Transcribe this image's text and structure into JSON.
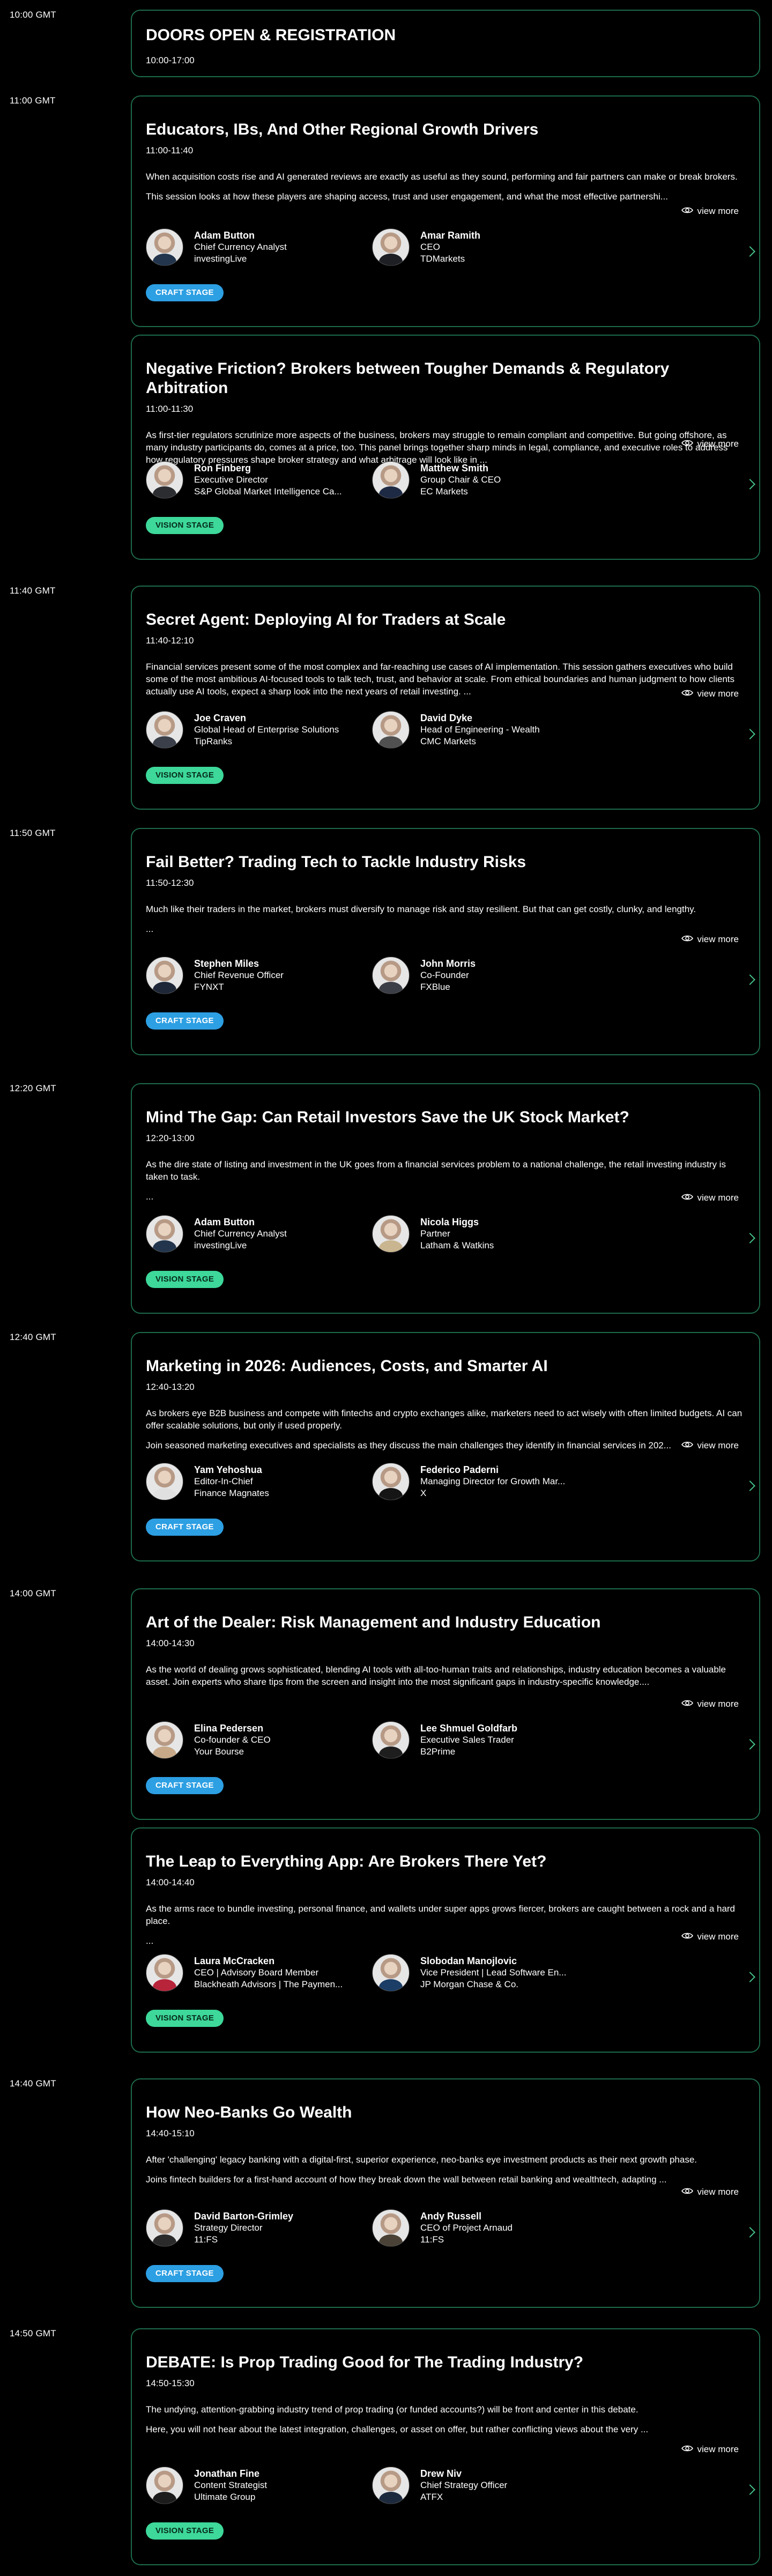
{
  "agenda": [
    {
      "time": "10:00 GMT",
      "sessions": [
        {
          "title": "DOORS OPEN & REGISTRATION",
          "time": "10:00-17:00",
          "simple": true
        }
      ]
    },
    {
      "time": "11:00 GMT",
      "sessions": [
        {
          "title": "Educators, IBs, And Other Regional Growth Drivers",
          "time": "11:00-11:40",
          "desc": [
            "When acquisition costs rise and AI generated reviews are exactly as useful as they sound, performing and fair partners can make or break brokers.",
            "This session looks at how these players are shaping access, trust and user engagement, and what the most effective partnershi..."
          ],
          "view_more": "view more",
          "speakers": [
            {
              "name": "Adam Button",
              "role": "Chief Currency Analyst",
              "org": "investingLive",
              "shirt": "#22354d"
            },
            {
              "name": "Amar Ramith",
              "role": "CEO",
              "org": "TDMarkets",
              "shirt": "#1d1f24"
            }
          ],
          "tag": "CRAFT STAGE",
          "tag_type": "craft"
        },
        {
          "title": "Negative Friction? Brokers between Tougher Demands & Regulatory Arbitration",
          "time": "11:00-11:30",
          "desc": [
            "As first-tier regulators scrutinize more aspects of the business, brokers may struggle to remain compliant and competitive. But going offshore, as many industry participants do, comes at a price, too.  This panel brings together sharp minds in legal, compliance, and executive roles to address how regulatory pressures shape broker strategy and what arbitrage will look like in ..."
          ],
          "view_more": "view more",
          "speakers": [
            {
              "name": "Ron Finberg",
              "role": "Executive Director",
              "org": "S&P Global Market Intelligence Ca...",
              "shirt": "#2b2d31"
            },
            {
              "name": "Matthew Smith",
              "role": "Group Chair & CEO",
              "org": "EC Markets",
              "shirt": "#1e2a44"
            }
          ],
          "tag": "VISION STAGE",
          "tag_type": "vision"
        }
      ]
    },
    {
      "time": "11:40 GMT",
      "sessions": [
        {
          "title": "Secret Agent: Deploying AI for Traders at Scale",
          "time": "11:40-12:10",
          "desc": [
            "Financial services present some of the most complex and far-reaching use cases of AI implementation. This session gathers executives who build some of the most ambitious AI-focused tools to talk tech, trust, and behavior at scale. From ethical boundaries and human judgment to how clients actually use AI tools, expect a sharp look into the next years of retail investing. ..."
          ],
          "view_more": "view more",
          "speakers": [
            {
              "name": "Joe Craven",
              "role": "Global Head of Enterprise Solutions",
              "org": "TipRanks",
              "shirt": "#3a3f4a"
            },
            {
              "name": "David Dyke",
              "role": "Head of Engineering - Wealth",
              "org": "CMC Markets",
              "shirt": "#505050"
            }
          ],
          "tag": "VISION STAGE",
          "tag_type": "vision"
        }
      ]
    },
    {
      "time": "11:50 GMT",
      "sessions": [
        {
          "title": "Fail Better? Trading Tech to Tackle Industry Risks",
          "time": "11:50-12:30",
          "desc": [
            "Much like their traders in the market, brokers must diversify to manage risk and stay resilient. But that can get costly, clunky, and lengthy.",
            "..."
          ],
          "view_more": "view more",
          "speakers": [
            {
              "name": "Stephen Miles",
              "role": "Chief Revenue Officer",
              "org": "FYNXT",
              "shirt": "#1d2738"
            },
            {
              "name": "John Morris",
              "role": "Co-Founder",
              "org": "FXBlue",
              "shirt": "#3b3e46"
            }
          ],
          "tag": "CRAFT STAGE",
          "tag_type": "craft"
        }
      ]
    },
    {
      "time": "12:20 GMT",
      "sessions": [
        {
          "title": "Mind The Gap: Can Retail Investors Save the UK Stock Market?",
          "time": "12:20-13:00",
          "desc": [
            "As the dire state of listing and investment in the UK goes from a financial services problem to a national challenge, the retail investing industry is taken to task.",
            "..."
          ],
          "view_more": "view more",
          "speakers": [
            {
              "name": "Adam Button",
              "role": "Chief Currency Analyst",
              "org": "investingLive",
              "shirt": "#22354d"
            },
            {
              "name": "Nicola Higgs",
              "role": "Partner",
              "org": "Latham & Watkins",
              "shirt": "#c9b58f"
            }
          ],
          "tag": "VISION STAGE",
          "tag_type": "vision"
        }
      ]
    },
    {
      "time": "12:40 GMT",
      "sessions": [
        {
          "title": "Marketing in 2026: Audiences, Costs, and Smarter AI",
          "time": "12:40-13:20",
          "desc": [
            "As brokers eye B2B business and compete with fintechs and crypto exchanges alike, marketers need to act wisely with often limited budgets. AI can offer scalable solutions, but only if used properly.",
            "Join seasoned marketing executives and specialists as they discuss the main challenges they identify in financial services in 202..."
          ],
          "view_more": "view more",
          "speakers": [
            {
              "name": "Yam Yehoshua",
              "role": "Editor-In-Chief",
              "org": "Finance Magnates",
              "shirt": "#e0e0e0"
            },
            {
              "name": "Federico Paderni",
              "role": "Managing Director for Growth Mar...",
              "org": "X",
              "shirt": "#151515"
            }
          ],
          "tag": "CRAFT STAGE",
          "tag_type": "craft"
        }
      ]
    },
    {
      "time": "14:00 GMT",
      "sessions": [
        {
          "title": "Art of the Dealer: Risk Management and Industry Education",
          "time": "14:00-14:30",
          "desc": [
            "As the world of dealing grows sophisticated, blending AI tools with all-too-human traits and relationships, industry education becomes a valuable asset. Join experts who share tips from the screen and insight into the most significant gaps in industry-specific knowledge...."
          ],
          "view_more": "view more",
          "speakers": [
            {
              "name": "Elina Pedersen",
              "role": "Co-founder & CEO",
              "org": "Your Bourse",
              "shirt": "#c7a98a"
            },
            {
              "name": "Lee Shmuel Goldfarb",
              "role": "Executive Sales Trader",
              "org": "B2Prime",
              "shirt": "#1e1e1e"
            }
          ],
          "tag": "CRAFT STAGE",
          "tag_type": "craft"
        },
        {
          "title": "The Leap to Everything App: Are Brokers There Yet?",
          "time": "14:00-14:40",
          "desc": [
            "As the arms race to bundle investing, personal finance, and wallets under super apps grows fiercer, brokers are caught between a rock and a hard place.",
            "..."
          ],
          "view_more": "view more",
          "speakers": [
            {
              "name": "Laura McCracken",
              "role": "CEO | Advisory Board Member",
              "org": "Blackheath Advisors | The Paymen...",
              "shirt": "#b8243a"
            },
            {
              "name": "Slobodan Manojlovic",
              "role": "Vice President | Lead Software En...",
              "org": "JP Morgan Chase & Co.",
              "shirt": "#1b3d66"
            }
          ],
          "tag": "VISION STAGE",
          "tag_type": "vision"
        }
      ]
    },
    {
      "time": "14:40 GMT",
      "sessions": [
        {
          "title": "How Neo-Banks Go Wealth",
          "time": "14:40-15:10",
          "desc": [
            "After 'challenging' legacy banking with a digital-first, superior experience, neo-banks eye investment products as their next growth phase.",
            "Joins fintech builders for a first-hand account of how they break down the wall between retail banking and wealthtech, adapting ..."
          ],
          "view_more": "view more",
          "speakers": [
            {
              "name": "David Barton-Grimley",
              "role": "Strategy Director",
              "org": "11:FS",
              "shirt": "#2a2a2a"
            },
            {
              "name": "Andy Russell",
              "role": "CEO of Project Arnaud",
              "org": "11:FS",
              "shirt": "#4a4236"
            }
          ],
          "tag": "CRAFT STAGE",
          "tag_type": "craft"
        }
      ]
    },
    {
      "time": "14:50 GMT",
      "sessions": [
        {
          "title": "DEBATE: Is Prop Trading Good for The Trading Industry?",
          "time": "14:50-15:30",
          "desc": [
            "The undying, attention-grabbing industry trend of prop trading (or funded accounts?) will be front and center in this debate.",
            "Here, you will not hear about the latest integration, challenges, or asset on offer, but rather conflicting views about the very ..."
          ],
          "view_more": "view more",
          "speakers": [
            {
              "name": "Jonathan Fine",
              "role": "Content Strategist",
              "org": "Ultimate Group",
              "shirt": "#1c1c1c"
            },
            {
              "name": "Drew Niv",
              "role": "Chief Strategy Officer",
              "org": "ATFX",
              "shirt": "#1d2a3e"
            }
          ],
          "tag": "VISION STAGE",
          "tag_type": "vision"
        }
      ]
    }
  ]
}
